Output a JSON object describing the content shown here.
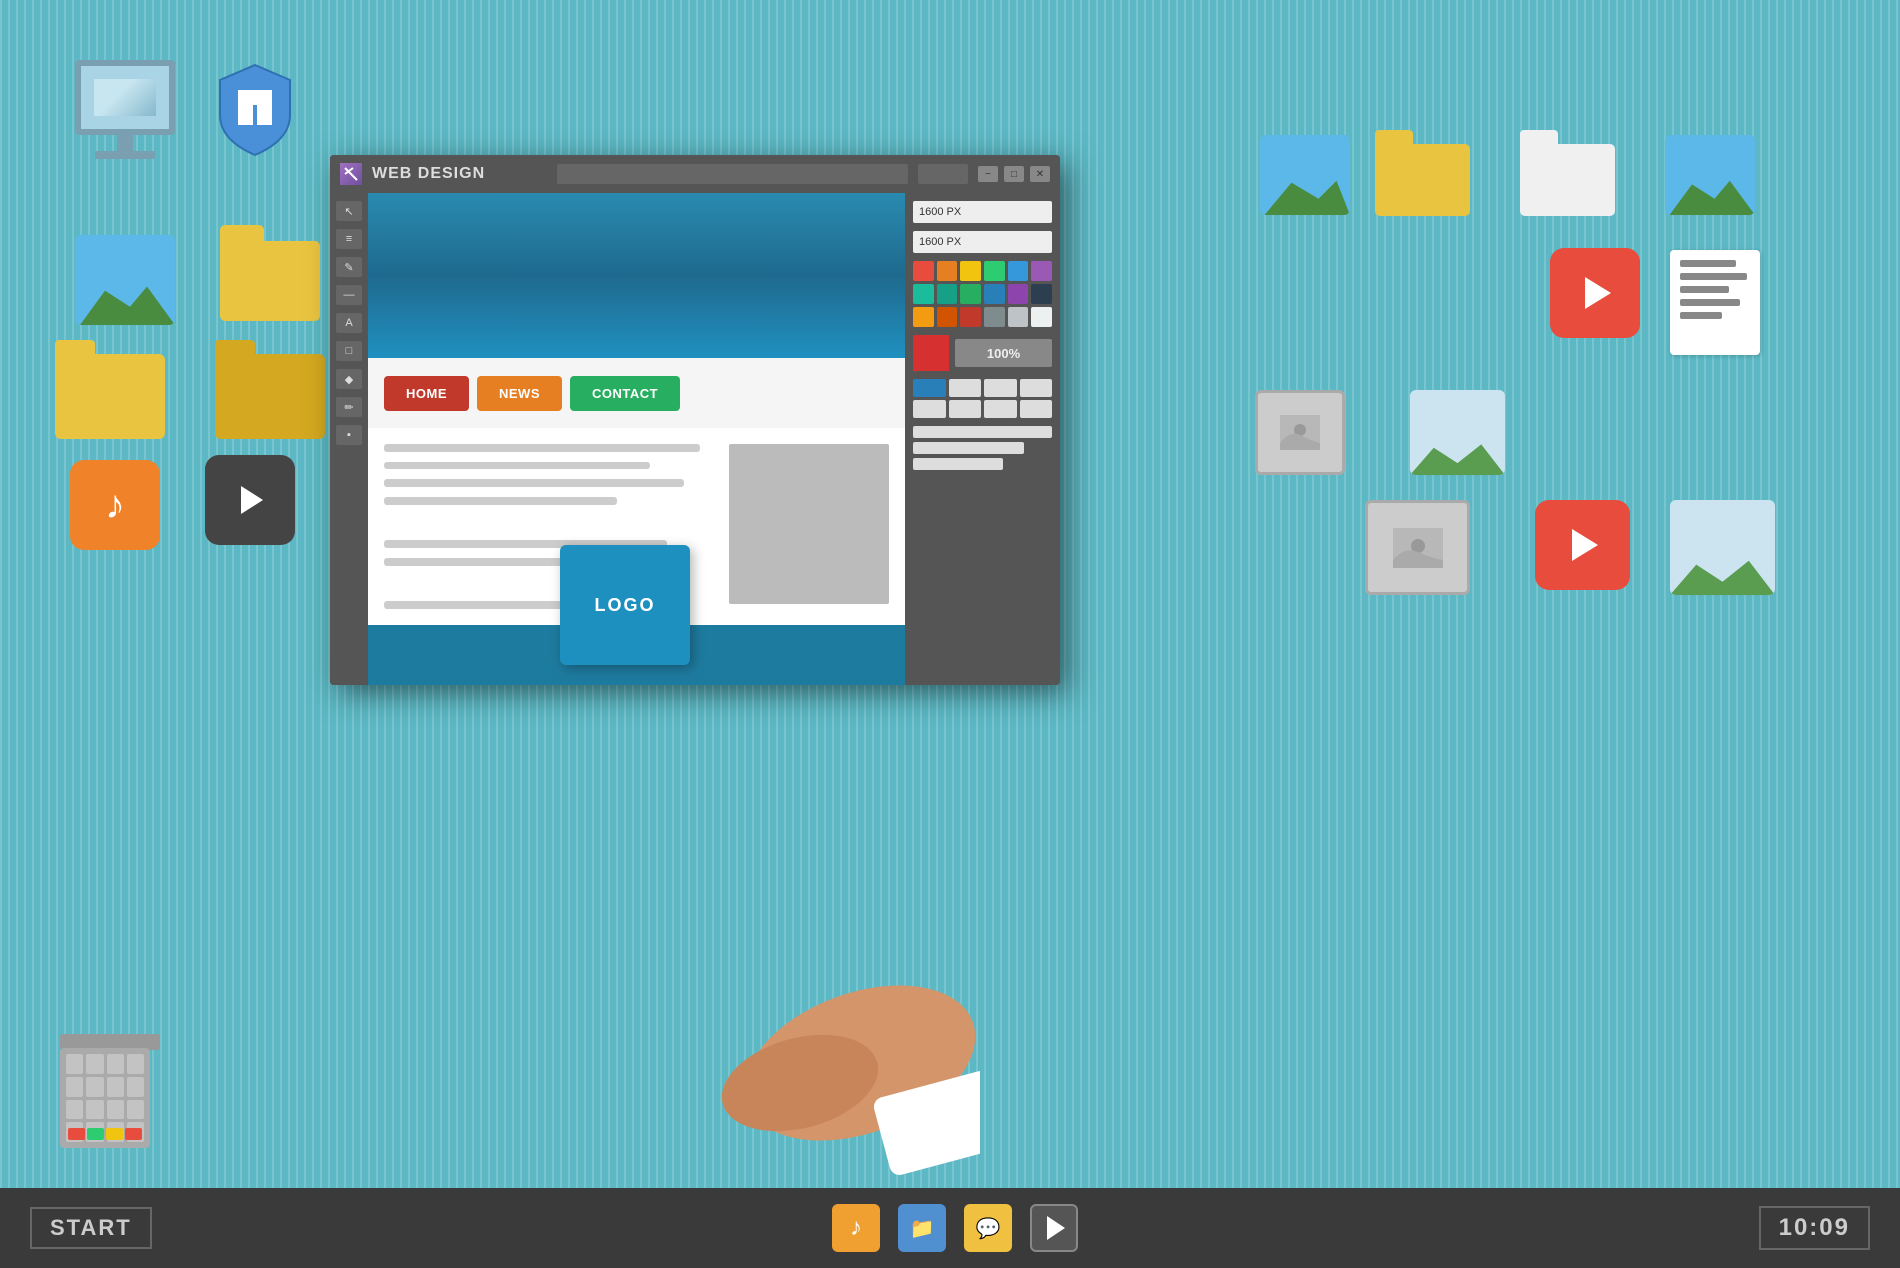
{
  "background": {
    "color": "#5bb8c4"
  },
  "taskbar": {
    "start_label": "START",
    "time": "10:09",
    "icons": [
      {
        "name": "music",
        "color": "#f0a030",
        "symbol": "♪"
      },
      {
        "name": "folder",
        "color": "#5090d0",
        "symbol": "📁"
      },
      {
        "name": "chat",
        "color": "#f0c040",
        "symbol": "💬"
      },
      {
        "name": "play",
        "color": "#60b030",
        "symbol": "▶"
      }
    ]
  },
  "main_window": {
    "title": "WEB DESIGN",
    "address_bar": "",
    "controls": [
      "−",
      "□",
      "✕"
    ],
    "size_inputs": [
      "1600 PX",
      "1600 PX"
    ],
    "zoom": "100%",
    "nav_buttons": [
      {
        "label": "HOME",
        "color": "#c0392b"
      },
      {
        "label": "NEWS",
        "color": "#e67e22"
      },
      {
        "label": "CONTACT",
        "color": "#27ae60"
      }
    ],
    "tools": [
      "↖",
      "≡",
      "✎",
      "▬",
      "A",
      "□",
      "◆",
      "✏"
    ],
    "color_swatches": [
      "#e74c3c",
      "#e67e22",
      "#f1c40f",
      "#2ecc71",
      "#3498db",
      "#9b59b6",
      "#1abc9c",
      "#16a085",
      "#27ae60",
      "#2980b9",
      "#8e44ad",
      "#2c3e50",
      "#f39c12",
      "#d35400",
      "#c0392b",
      "#7f8c8d",
      "#bdc3c7",
      "#ecf0f1"
    ]
  },
  "logo_card": {
    "text": "LOGO"
  },
  "desktop_items": {
    "monitor": "Monitor",
    "shield": "Shield",
    "folders": [
      "folder1",
      "folder2",
      "folder3"
    ],
    "trash": "Recycle Bin"
  }
}
